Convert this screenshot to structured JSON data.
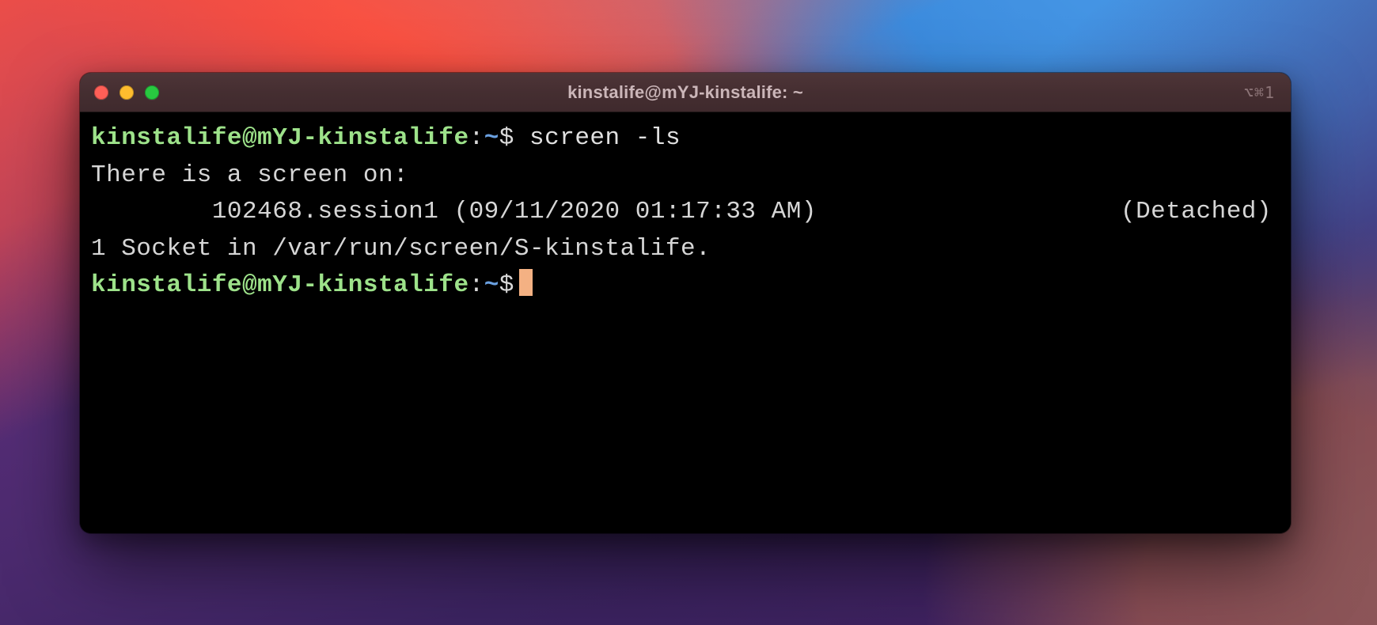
{
  "window": {
    "title": "kinstalife@mYJ-kinstalife: ~",
    "shortcut_hint": "⌥⌘1"
  },
  "prompt": {
    "user_host": "kinstalife@mYJ-kinstalife",
    "separator": ":",
    "path": "~",
    "symbol": "$"
  },
  "lines": {
    "command1": "screen -ls",
    "output_header": "There is a screen on:",
    "session_indent": "        ",
    "session_entry": "102468.session1 (09/11/2020 01:17:33 AM)",
    "session_status": "(Detached)",
    "socket_line": "1 Socket in /var/run/screen/S-kinstalife."
  }
}
